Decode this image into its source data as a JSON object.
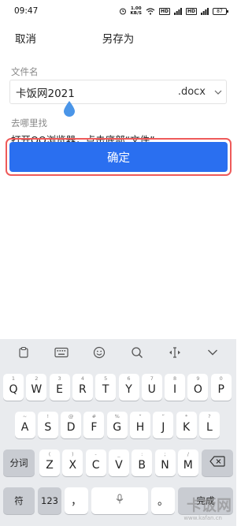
{
  "status_bar": {
    "time": "09:47",
    "speed_value": "1.00",
    "speed_unit": "KB/S",
    "battery": "87",
    "hd1": "HD",
    "hd2": "HD"
  },
  "header": {
    "cancel_label": "取消",
    "title": "另存为"
  },
  "form": {
    "filename_label": "文件名",
    "filename_value": "卡饭网2021",
    "extension": ".docx",
    "location_label": "去哪里找",
    "location_text": "打开QQ浏览器，点击底部“文件”"
  },
  "confirm_label": "确定",
  "keyboard": {
    "row1": [
      {
        "hint": "1",
        "ch": "Q"
      },
      {
        "hint": "2",
        "ch": "W"
      },
      {
        "hint": "3",
        "ch": "E"
      },
      {
        "hint": "4",
        "ch": "R"
      },
      {
        "hint": "5",
        "ch": "T"
      },
      {
        "hint": "6",
        "ch": "Y"
      },
      {
        "hint": "7",
        "ch": "U"
      },
      {
        "hint": "8",
        "ch": "I"
      },
      {
        "hint": "9",
        "ch": "O"
      },
      {
        "hint": "0",
        "ch": "P"
      }
    ],
    "row2": [
      {
        "hint": "~",
        "ch": "A"
      },
      {
        "hint": "!",
        "ch": "S"
      },
      {
        "hint": "@",
        "ch": "D"
      },
      {
        "hint": "#",
        "ch": "F"
      },
      {
        "hint": "%",
        "ch": "G"
      },
      {
        "hint": "“",
        "ch": "H"
      },
      {
        "hint": "”",
        "ch": "J"
      },
      {
        "hint": "*",
        "ch": "K"
      },
      {
        "hint": "?",
        "ch": "L"
      }
    ],
    "row3": [
      {
        "hint": "(",
        "ch": "Z"
      },
      {
        "hint": ")",
        "ch": "X"
      },
      {
        "hint": "-",
        "ch": "C"
      },
      {
        "hint": "_",
        "ch": "V"
      },
      {
        "hint": ":",
        "ch": "B"
      },
      {
        "hint": ";",
        "ch": "N"
      },
      {
        "hint": "/",
        "ch": "M"
      }
    ],
    "shift_label": "分词",
    "symbol_label": "符",
    "num_label": "123",
    "comma_label": "，",
    "period_label": "。",
    "done_label": "完成"
  },
  "watermark": {
    "main": "卡饭网",
    "sub": "www.kafan.cn"
  }
}
